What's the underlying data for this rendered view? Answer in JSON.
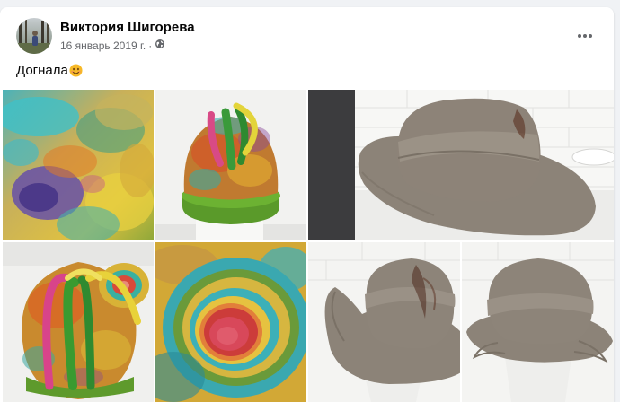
{
  "post": {
    "author": "Виктория Шигорева",
    "date": "16 январь 2019 г.",
    "separator": "·",
    "text": "Догнала",
    "emoji": "smiling-face-emoji",
    "privacy_icon": "globe-icon",
    "more_icon": "more-options-icon"
  },
  "photos": [
    {
      "name": "felt-texture-closeup",
      "icon": "photo"
    },
    {
      "name": "colorful-felt-hat-top",
      "icon": "photo"
    },
    {
      "name": "taupe-brimmed-hat",
      "icon": "photo"
    },
    {
      "name": "colorful-felt-hat-side",
      "icon": "photo"
    },
    {
      "name": "felt-spiral-closeup",
      "icon": "photo"
    },
    {
      "name": "taupe-hat-front",
      "icon": "photo"
    },
    {
      "name": "taupe-hat-back",
      "icon": "photo"
    }
  ],
  "colors": {
    "accent": "#1877f2",
    "text": "#050505",
    "secondary": "#65676b"
  }
}
